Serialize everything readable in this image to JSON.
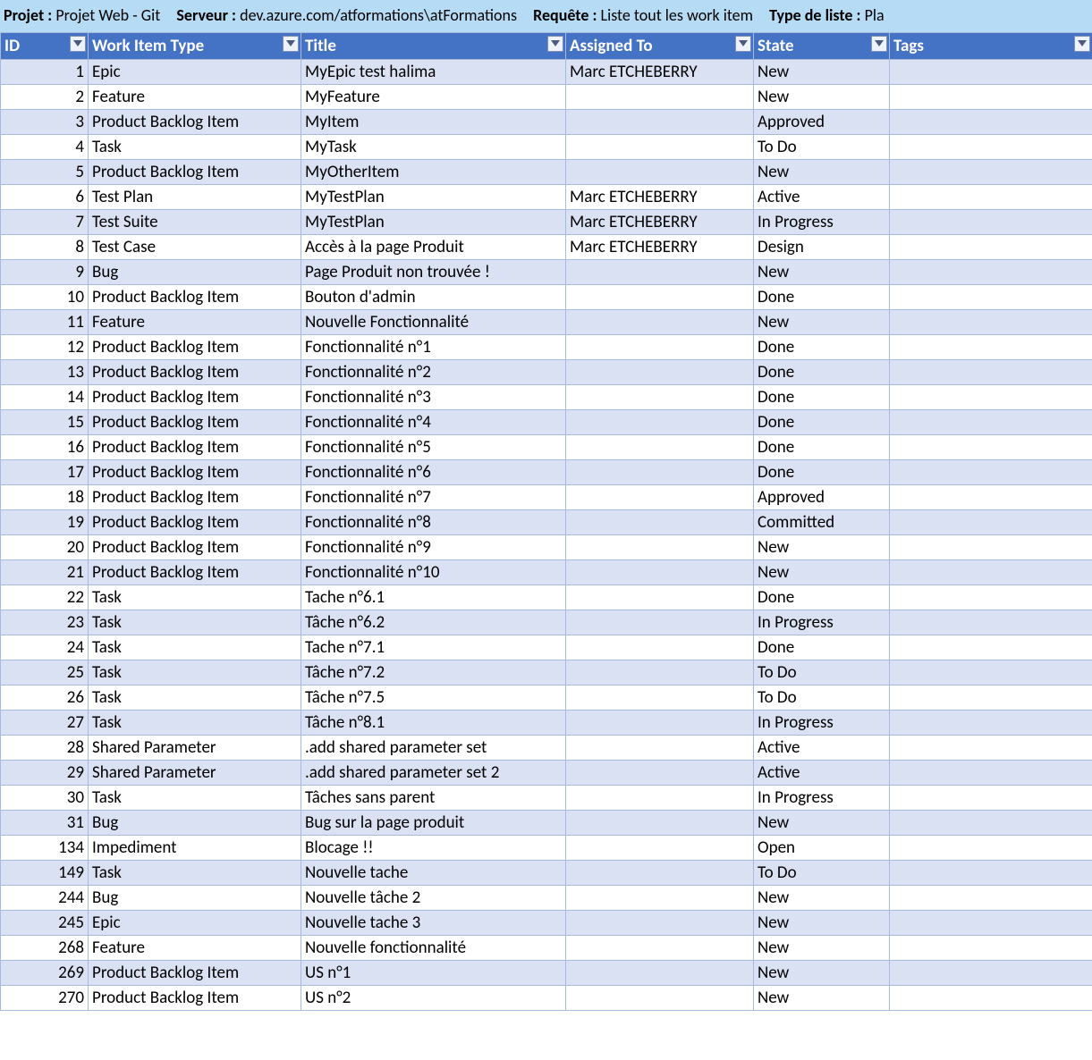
{
  "info": {
    "projet_label": "Projet :",
    "projet_value": "Projet Web - Git",
    "serveur_label": "Serveur :",
    "serveur_value": "dev.azure.com/atformations\\atFormations",
    "requete_label": "Requête :",
    "requete_value": "Liste tout les work item",
    "type_label": "Type de liste :",
    "type_value": "Pla"
  },
  "headers": {
    "id": "ID",
    "work_item_type": "Work Item Type",
    "title": "Title",
    "assigned_to": "Assigned To",
    "state": "State",
    "tags": "Tags"
  },
  "rows": [
    {
      "id": "1",
      "type": "Epic",
      "title": "MyEpic test halima",
      "assigned": "Marc ETCHEBERRY",
      "state": "New",
      "tags": ""
    },
    {
      "id": "2",
      "type": "Feature",
      "title": "MyFeature",
      "assigned": "",
      "state": "New",
      "tags": ""
    },
    {
      "id": "3",
      "type": "Product Backlog Item",
      "title": "MyItem",
      "assigned": "",
      "state": "Approved",
      "tags": ""
    },
    {
      "id": "4",
      "type": "Task",
      "title": "MyTask",
      "assigned": "",
      "state": "To Do",
      "tags": ""
    },
    {
      "id": "5",
      "type": "Product Backlog Item",
      "title": "MyOtherItem",
      "assigned": "",
      "state": "New",
      "tags": ""
    },
    {
      "id": "6",
      "type": "Test Plan",
      "title": "MyTestPlan",
      "assigned": "Marc ETCHEBERRY",
      "state": "Active",
      "tags": ""
    },
    {
      "id": "7",
      "type": "Test Suite",
      "title": "MyTestPlan",
      "assigned": "Marc ETCHEBERRY",
      "state": "In Progress",
      "tags": ""
    },
    {
      "id": "8",
      "type": "Test Case",
      "title": "Accès à la page Produit",
      "assigned": "Marc ETCHEBERRY",
      "state": "Design",
      "tags": ""
    },
    {
      "id": "9",
      "type": "Bug",
      "title": "Page Produit non trouvée !",
      "assigned": "",
      "state": "New",
      "tags": ""
    },
    {
      "id": "10",
      "type": "Product Backlog Item",
      "title": "Bouton d'admin",
      "assigned": "",
      "state": "Done",
      "tags": ""
    },
    {
      "id": "11",
      "type": "Feature",
      "title": "Nouvelle Fonctionnalité",
      "assigned": "",
      "state": "New",
      "tags": ""
    },
    {
      "id": "12",
      "type": "Product Backlog Item",
      "title": "Fonctionnalité n°1",
      "assigned": "",
      "state": "Done",
      "tags": ""
    },
    {
      "id": "13",
      "type": "Product Backlog Item",
      "title": "Fonctionnalité n°2",
      "assigned": "",
      "state": "Done",
      "tags": ""
    },
    {
      "id": "14",
      "type": "Product Backlog Item",
      "title": "Fonctionnalité n°3",
      "assigned": "",
      "state": "Done",
      "tags": ""
    },
    {
      "id": "15",
      "type": "Product Backlog Item",
      "title": "Fonctionnalité n°4",
      "assigned": "",
      "state": "Done",
      "tags": ""
    },
    {
      "id": "16",
      "type": "Product Backlog Item",
      "title": "Fonctionnalité n°5",
      "assigned": "",
      "state": "Done",
      "tags": ""
    },
    {
      "id": "17",
      "type": "Product Backlog Item",
      "title": "Fonctionnalité n°6",
      "assigned": "",
      "state": "Done",
      "tags": ""
    },
    {
      "id": "18",
      "type": "Product Backlog Item",
      "title": "Fonctionnalité n°7",
      "assigned": "",
      "state": "Approved",
      "tags": ""
    },
    {
      "id": "19",
      "type": "Product Backlog Item",
      "title": "Fonctionnalité n°8",
      "assigned": "",
      "state": "Committed",
      "tags": ""
    },
    {
      "id": "20",
      "type": "Product Backlog Item",
      "title": "Fonctionnalité n°9",
      "assigned": "",
      "state": "New",
      "tags": ""
    },
    {
      "id": "21",
      "type": "Product Backlog Item",
      "title": "Fonctionnalité n°10",
      "assigned": "",
      "state": "New",
      "tags": ""
    },
    {
      "id": "22",
      "type": "Task",
      "title": "Tache n°6.1",
      "assigned": "",
      "state": "Done",
      "tags": ""
    },
    {
      "id": "23",
      "type": "Task",
      "title": "Tâche n°6.2",
      "assigned": "",
      "state": "In Progress",
      "tags": ""
    },
    {
      "id": "24",
      "type": "Task",
      "title": "Tache n°7.1",
      "assigned": "",
      "state": "Done",
      "tags": ""
    },
    {
      "id": "25",
      "type": "Task",
      "title": "Tâche n°7.2",
      "assigned": "",
      "state": "To Do",
      "tags": ""
    },
    {
      "id": "26",
      "type": "Task",
      "title": "Tâche n°7.5",
      "assigned": "",
      "state": "To Do",
      "tags": ""
    },
    {
      "id": "27",
      "type": "Task",
      "title": "Tâche n°8.1",
      "assigned": "",
      "state": "In Progress",
      "tags": ""
    },
    {
      "id": "28",
      "type": "Shared Parameter",
      "title": ".add shared parameter set",
      "assigned": "",
      "state": "Active",
      "tags": ""
    },
    {
      "id": "29",
      "type": "Shared Parameter",
      "title": ".add shared parameter set 2",
      "assigned": "",
      "state": "Active",
      "tags": ""
    },
    {
      "id": "30",
      "type": "Task",
      "title": "Tâches sans parent",
      "assigned": "",
      "state": "In Progress",
      "tags": ""
    },
    {
      "id": "31",
      "type": "Bug",
      "title": "Bug sur la page produit",
      "assigned": "",
      "state": "New",
      "tags": ""
    },
    {
      "id": "134",
      "type": "Impediment",
      "title": "Blocage !!",
      "assigned": "",
      "state": "Open",
      "tags": ""
    },
    {
      "id": "149",
      "type": "Task",
      "title": "Nouvelle tache",
      "assigned": "",
      "state": "To Do",
      "tags": ""
    },
    {
      "id": "244",
      "type": "Bug",
      "title": "Nouvelle tâche 2",
      "assigned": "",
      "state": "New",
      "tags": ""
    },
    {
      "id": "245",
      "type": "Epic",
      "title": "Nouvelle tache 3",
      "assigned": "",
      "state": "New",
      "tags": ""
    },
    {
      "id": "268",
      "type": "Feature",
      "title": "Nouvelle fonctionnalité",
      "assigned": "",
      "state": "New",
      "tags": ""
    },
    {
      "id": "269",
      "type": "Product Backlog Item",
      "title": "US n°1",
      "assigned": "",
      "state": "New",
      "tags": ""
    },
    {
      "id": "270",
      "type": "Product Backlog Item",
      "title": "US n°2",
      "assigned": "",
      "state": "New",
      "tags": ""
    }
  ]
}
